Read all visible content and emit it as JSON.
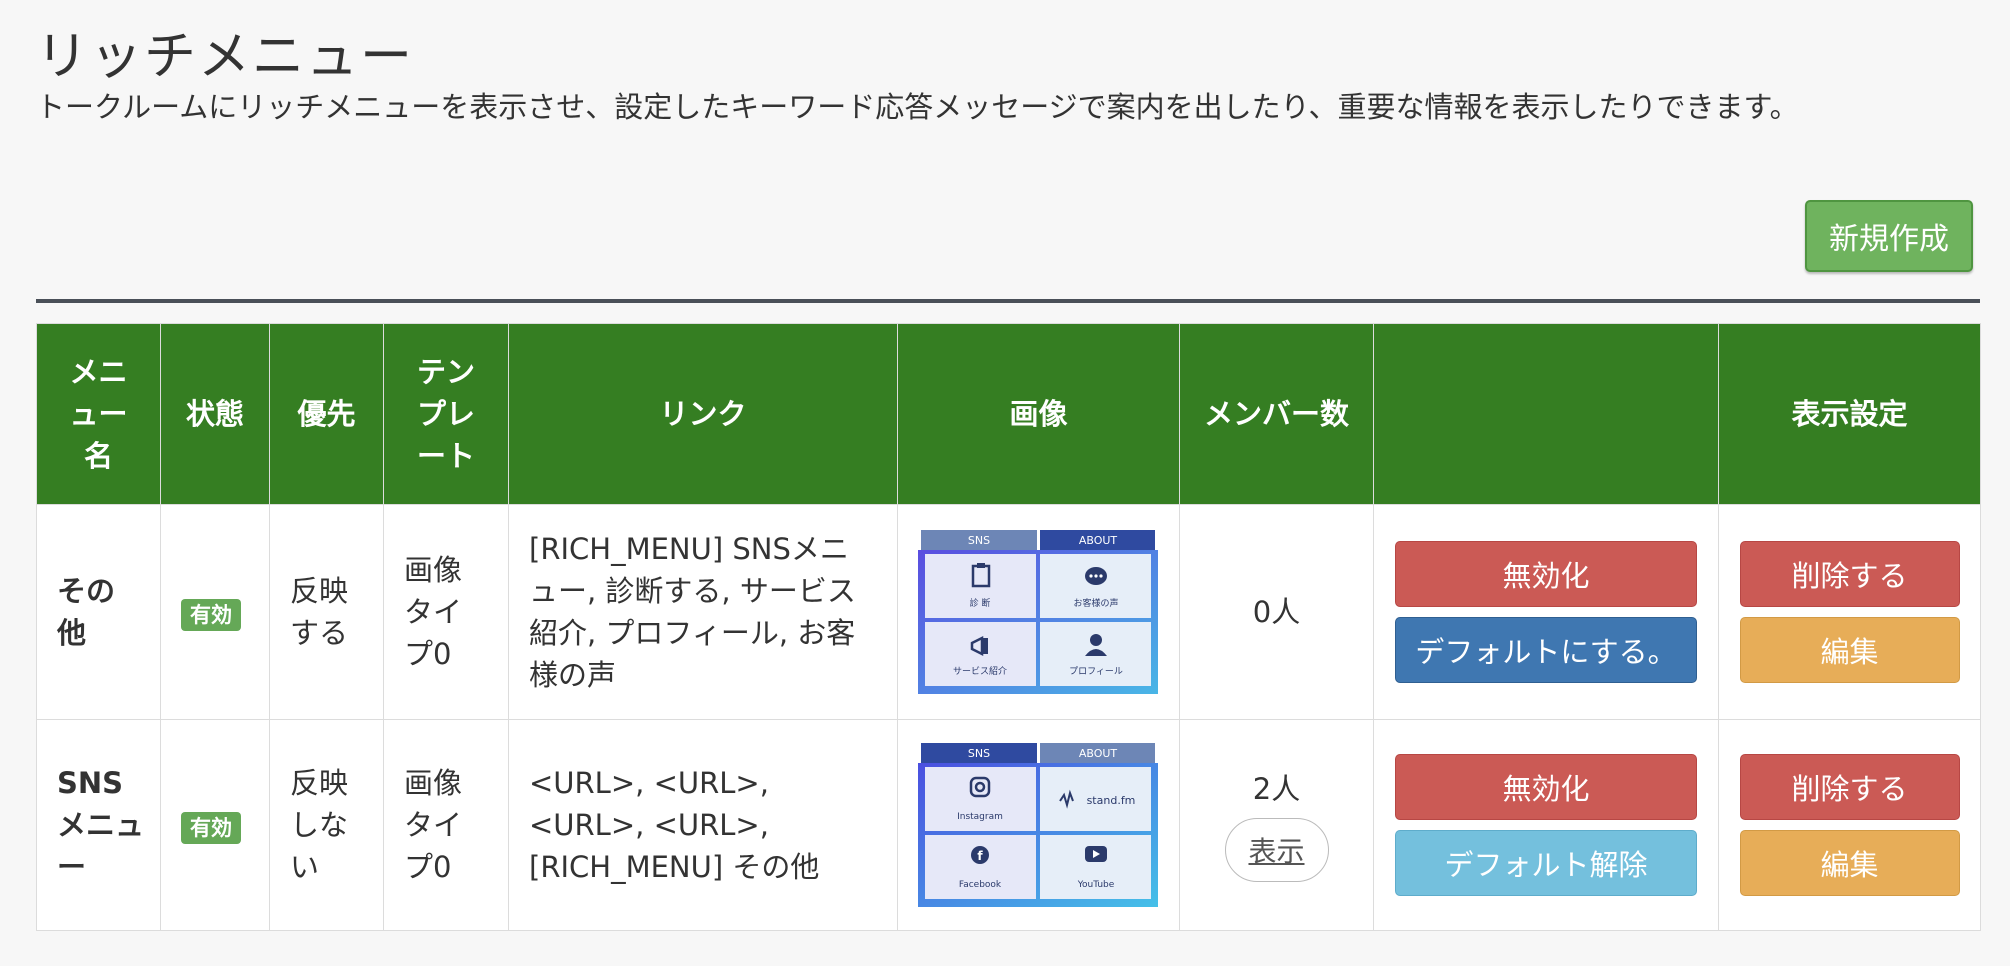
{
  "page": {
    "title": "リッチメニュー",
    "description": "トークルームにリッチメニューを表示させ、設定したキーワード応答メッセージで案内を出したり、重要な情報を表示したりできます。",
    "new_button": "新規作成"
  },
  "table": {
    "headers": {
      "name": "メニュー名",
      "status": "状態",
      "priority": "優先",
      "template": "テンプレート",
      "link": "リンク",
      "image": "画像",
      "members": "メンバー数",
      "actions": "",
      "display": "表示設定"
    },
    "rows": [
      {
        "name": "その他",
        "status": "有効",
        "priority": "反映する",
        "template": "画像タイプ0",
        "link": "[RICH_MENU] SNSメニュー, 診断する, サービス紹介, プロフィール, お客様の声",
        "image": {
          "tabs": [
            "SNS",
            "ABOUT"
          ],
          "tiles": [
            "診 断",
            "お客様の声",
            "サービス紹介",
            "プロフィール"
          ],
          "icons": [
            "clipboard-icon",
            "chat-bubble-icon",
            "megaphone-icon",
            "person-icon"
          ]
        },
        "members": "0人",
        "show_button": null,
        "primary_action": "無効化",
        "secondary_action": "デフォルトにする。",
        "delete": "削除する",
        "edit": "編集"
      },
      {
        "name": "SNSメニュー",
        "status": "有効",
        "priority": "反映しない",
        "template": "画像タイプ0",
        "link": "<URL>, <URL>, <URL>, <URL>, [RICH_MENU] その他",
        "image": {
          "tabs": [
            "SNS",
            "ABOUT"
          ],
          "tiles": [
            "Instagram",
            "stand.fm",
            "Facebook",
            "YouTube"
          ],
          "icons": [
            "instagram-icon",
            "standfm-icon",
            "facebook-icon",
            "youtube-icon"
          ]
        },
        "members": "2人",
        "show_button": "表示",
        "primary_action": "無効化",
        "secondary_action": "デフォルト解除",
        "delete": "削除する",
        "edit": "編集"
      }
    ]
  },
  "colors": {
    "header_green": "#357e22",
    "new_button_green": "#6fb35e",
    "danger_red": "#cb5a55",
    "primary_blue": "#3f77b1",
    "info_lightblue": "#74c0dd",
    "warning_orange": "#e7ad58",
    "badge_green": "#65a857"
  }
}
